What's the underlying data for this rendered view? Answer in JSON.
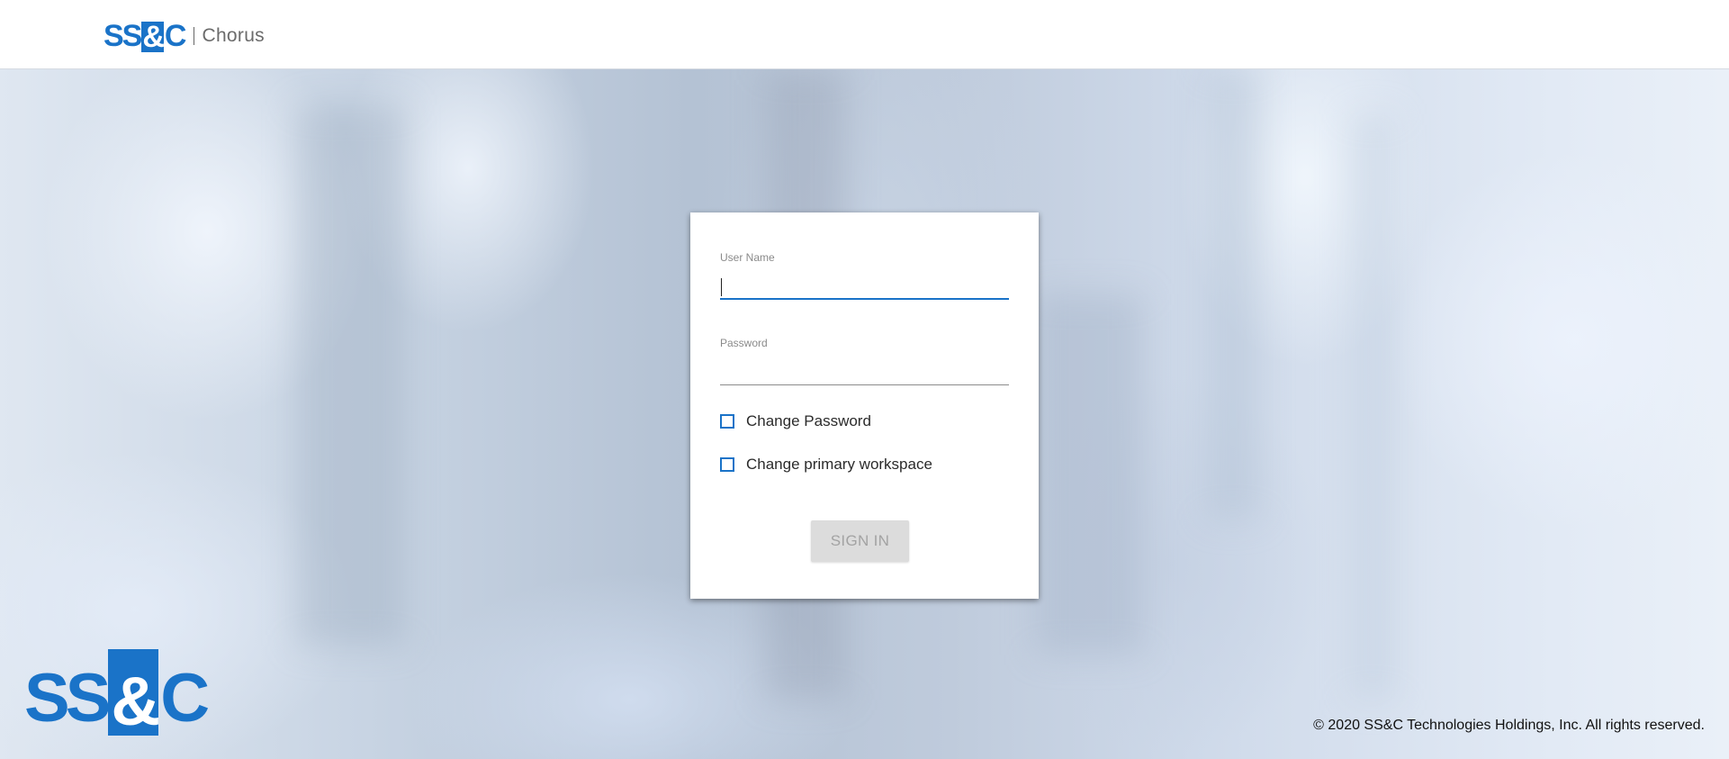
{
  "header": {
    "logo_parts": [
      "SS",
      "&",
      "C"
    ],
    "product_name": "Chorus"
  },
  "login": {
    "username_label": "User Name",
    "username_value": "",
    "password_label": "Password",
    "password_value": "",
    "change_password_label": "Change Password",
    "change_password_checked": false,
    "change_workspace_label": "Change primary workspace",
    "change_workspace_checked": false,
    "signin_label": "SIGN IN"
  },
  "footer": {
    "logo_parts": [
      "SS",
      "&",
      "C"
    ],
    "copyright": "© 2020 SS&C Technologies Holdings, Inc. All rights reserved."
  },
  "colors": {
    "brand_blue": "#1a73c8",
    "button_disabled_bg": "#dcdcdc",
    "button_disabled_text": "#a3a3a3"
  }
}
